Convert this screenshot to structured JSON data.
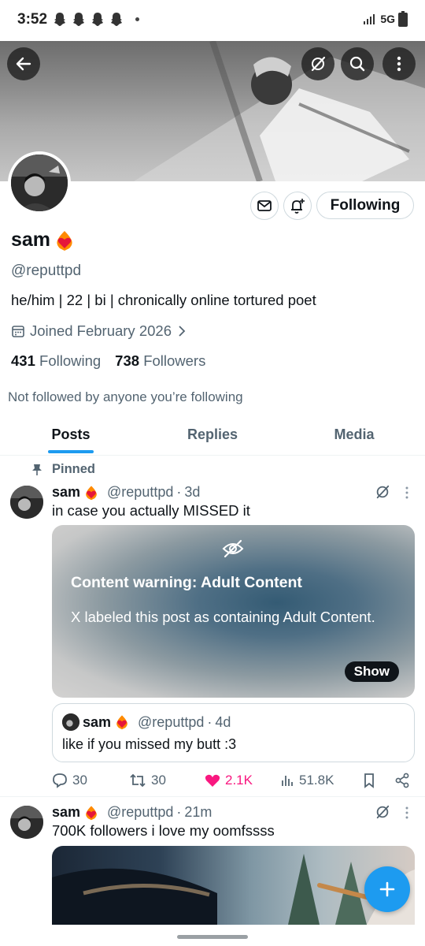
{
  "status_bar": {
    "time": "3:52",
    "network": "5G"
  },
  "profile": {
    "display_name": "sam",
    "handle": "@reputtpd",
    "bio": "he/him | 22 | bi | chronically online tortured poet",
    "joined": "Joined February 2026",
    "following_count": "431",
    "following_label": "Following",
    "followers_count": "738",
    "followers_label": "Followers",
    "mutuals_note": "Not followed by anyone you’re following",
    "follow_button": "Following"
  },
  "tabs": [
    {
      "label": "Posts"
    },
    {
      "label": "Replies"
    },
    {
      "label": "Media"
    }
  ],
  "posts": [
    {
      "pinned_label": "Pinned",
      "author": "sam",
      "handle": "@reputtpd",
      "time": "3d",
      "text": "in case you actually MISSED it",
      "content_warning": {
        "title": "Content warning: Adult Content",
        "text": "X labeled this post as containing Adult Content.",
        "show": "Show"
      },
      "quote": {
        "author": "sam",
        "handle": "@reputtpd",
        "time": "4d",
        "text": "like if you missed my butt :3"
      },
      "replies": "30",
      "reposts": "30",
      "likes": "2.1K",
      "views": "51.8K"
    },
    {
      "author": "sam",
      "handle": "@reputtpd",
      "time": "21m",
      "text": "700K followers i love my oomfssss"
    }
  ],
  "colors": {
    "accent": "#1d9bf0",
    "like": "#f91880",
    "muted": "#536471"
  }
}
